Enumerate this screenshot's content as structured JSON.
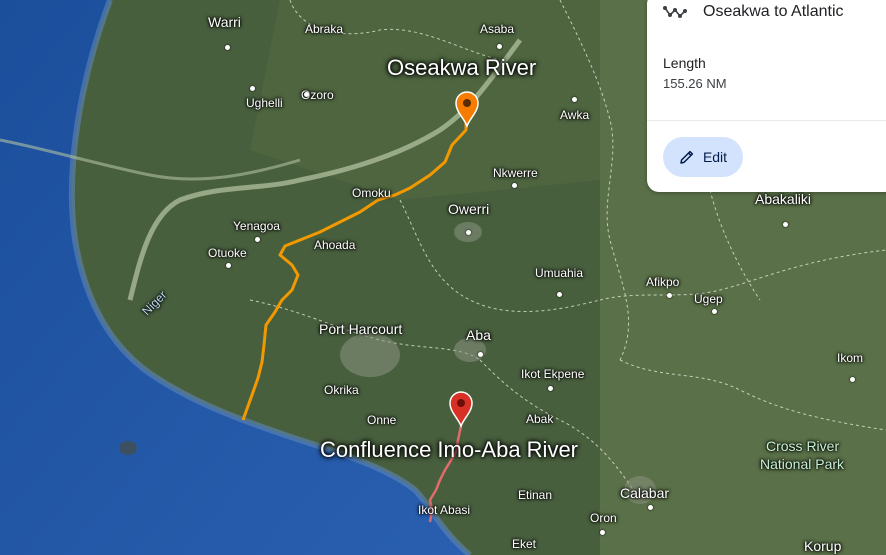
{
  "panel": {
    "title": "Oseakwa to Atlantic",
    "route_icon": "route-icon",
    "length_label": "Length",
    "length_value": "155.26 NM",
    "edit_label": "Edit",
    "edit_icon": "pencil-icon"
  },
  "markers": {
    "start": {
      "label": "Oseakwa River",
      "color": "#f57c00"
    },
    "end": {
      "label": "Confluence Imo-Aba River",
      "color": "#d93025"
    }
  },
  "route_colors": {
    "main": "#f29900",
    "secondary": "#e06c6c"
  },
  "places": {
    "warri": "Warri",
    "abraka": "Abraka",
    "asaba": "Asaba",
    "ughelli": "Ughelli",
    "ozoro": "Ozoro",
    "awka": "Awka",
    "nkwerre": "Nkwerre",
    "omoku": "Omoku",
    "owerri": "Owerri",
    "yenagoa": "Yenagoa",
    "otuoke": "Otuoke",
    "ahoada": "Ahoada",
    "abakaliki": "Abakaliki",
    "umuahia": "Umuahia",
    "afikpo": "Afikpo",
    "ugep": "Ugep",
    "port_harcourt": "Port Harcourt",
    "aba": "Aba",
    "ikom": "Ikom",
    "okrika": "Okrika",
    "ikot_ekpene": "Ikot Ekpene",
    "onne": "Onne",
    "abak": "Abak",
    "cross_river_np_1": "Cross River",
    "cross_river_np_2": "National Park",
    "calabar": "Calabar",
    "etinan": "Etinan",
    "ikot_abasi": "Ikot Abasi",
    "oron": "Oron",
    "eket": "Eket",
    "korup": "Korup",
    "niger": "Niger"
  }
}
